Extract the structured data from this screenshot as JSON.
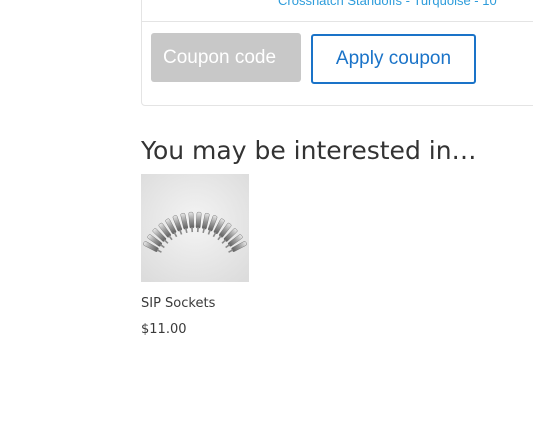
{
  "cart": {
    "previous_item_text": "Crosshatch Standoffs - Turquoise - 10"
  },
  "coupon": {
    "placeholder": "Coupon code",
    "apply_label": "Apply coupon"
  },
  "cross_sells": {
    "heading": "You may be interested in…",
    "products": [
      {
        "name": "SIP Sockets",
        "price": "$11.00",
        "image_icon": "sip-sockets-product-photo"
      }
    ]
  },
  "colors": {
    "accent": "#1a73c8",
    "link": "#2d9cdb",
    "coupon_input_bg": "#c8c8c8",
    "border": "#e4e4e4"
  }
}
